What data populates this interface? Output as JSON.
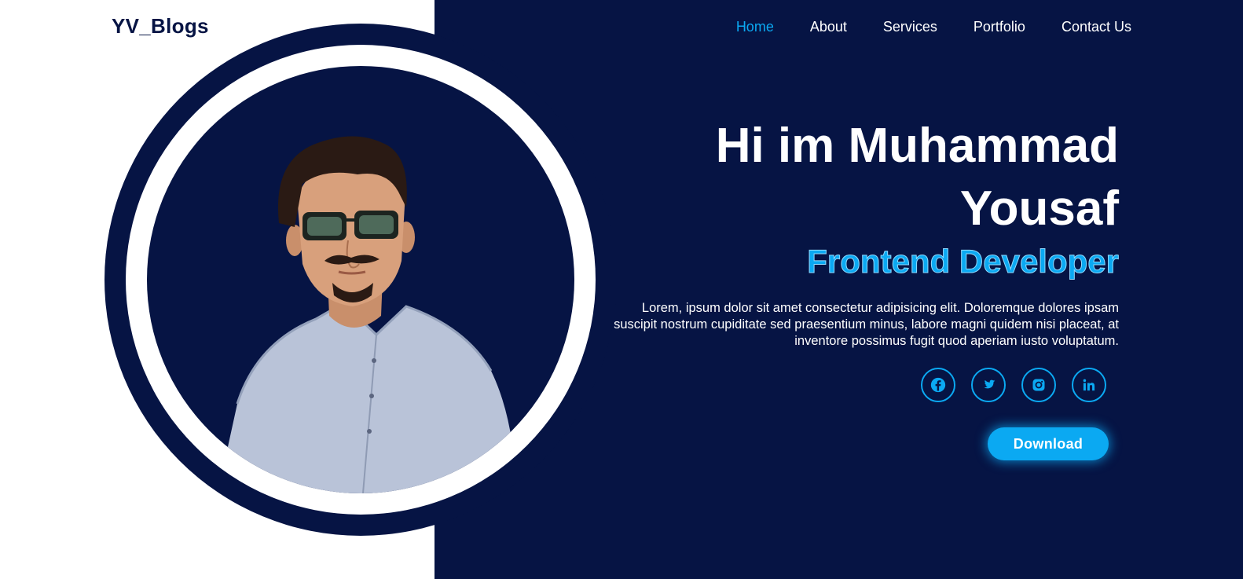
{
  "brand": {
    "logo": "YV_Blogs"
  },
  "nav": {
    "items": [
      {
        "label": "Home",
        "active": true
      },
      {
        "label": "About",
        "active": false
      },
      {
        "label": "Services",
        "active": false
      },
      {
        "label": "Portfolio",
        "active": false
      },
      {
        "label": "Contact Us",
        "active": false
      }
    ]
  },
  "hero": {
    "title_line1": "Hi im Muhammad",
    "title_line2": "Yousaf",
    "role": "Frontend Developer",
    "description": "Lorem, ipsum dolor sit amet consectetur adipisicing elit. Doloremque dolores ipsam suscipit nostrum cupiditate sed praesentium minus, labore magni quidem nisi placeat, at inventore possimus fugit quod aperiam iusto voluptatum.",
    "download_label": "Download"
  },
  "socials": [
    {
      "icon": "facebook-icon"
    },
    {
      "icon": "twitter-icon"
    },
    {
      "icon": "instagram-icon"
    },
    {
      "icon": "linkedin-icon"
    }
  ],
  "colors": {
    "navy": "#061444",
    "accent": "#0ba9f2",
    "white": "#ffffff"
  }
}
